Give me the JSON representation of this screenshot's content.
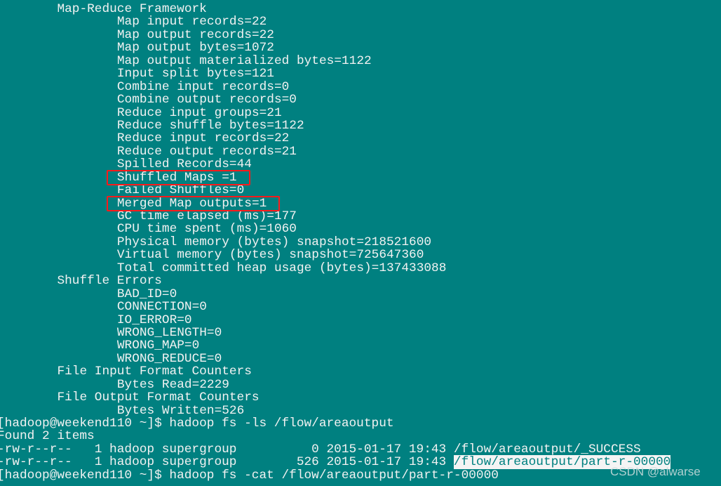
{
  "terminal": {
    "background": "#008080",
    "lines": [
      {
        "indent": 1,
        "text": "Map-Reduce Framework"
      },
      {
        "indent": 2,
        "text": "Map input records=22"
      },
      {
        "indent": 2,
        "text": "Map output records=22"
      },
      {
        "indent": 2,
        "text": "Map output bytes=1072"
      },
      {
        "indent": 2,
        "text": "Map output materialized bytes=1122"
      },
      {
        "indent": 2,
        "text": "Input split bytes=121"
      },
      {
        "indent": 2,
        "text": "Combine input records=0"
      },
      {
        "indent": 2,
        "text": "Combine output records=0"
      },
      {
        "indent": 2,
        "text": "Reduce input groups=21"
      },
      {
        "indent": 2,
        "text": "Reduce shuffle bytes=1122"
      },
      {
        "indent": 2,
        "text": "Reduce input records=22"
      },
      {
        "indent": 2,
        "text": "Reduce output records=21"
      },
      {
        "indent": 2,
        "text": "Spilled Records=44"
      },
      {
        "indent": 2,
        "text": "Shuffled Maps =1",
        "boxed": true
      },
      {
        "indent": 2,
        "text": "Failed Shuffles=0"
      },
      {
        "indent": 2,
        "text": "Merged Map outputs=1",
        "boxed": true
      },
      {
        "indent": 2,
        "text": "GC time elapsed (ms)=177"
      },
      {
        "indent": 2,
        "text": "CPU time spent (ms)=1060"
      },
      {
        "indent": 2,
        "text": "Physical memory (bytes) snapshot=218521600"
      },
      {
        "indent": 2,
        "text": "Virtual memory (bytes) snapshot=725647360"
      },
      {
        "indent": 2,
        "text": "Total committed heap usage (bytes)=137433088"
      },
      {
        "indent": 1,
        "text": "Shuffle Errors"
      },
      {
        "indent": 2,
        "text": "BAD_ID=0"
      },
      {
        "indent": 2,
        "text": "CONNECTION=0"
      },
      {
        "indent": 2,
        "text": "IO_ERROR=0"
      },
      {
        "indent": 2,
        "text": "WRONG_LENGTH=0"
      },
      {
        "indent": 2,
        "text": "WRONG_MAP=0"
      },
      {
        "indent": 2,
        "text": "WRONG_REDUCE=0"
      },
      {
        "indent": 1,
        "text": "File Input Format Counters"
      },
      {
        "indent": 2,
        "text": "Bytes Read=2229"
      },
      {
        "indent": 1,
        "text": "File Output Format Counters"
      },
      {
        "indent": 2,
        "text": "Bytes Written=526"
      },
      {
        "indent": 0,
        "text": "[hadoop@weekend110 ~]$ hadoop fs -ls /flow/areaoutput"
      },
      {
        "indent": 0,
        "text": "Found 2 items"
      },
      {
        "indent": 0,
        "text": "-rw-r--r--   1 hadoop supergroup          0 2015-01-17 19:43 /flow/areaoutput/_SUCCESS"
      },
      {
        "indent": 0,
        "text": "-rw-r--r--   1 hadoop supergroup        526 2015-01-17 19:43 ",
        "highlight": "/flow/areaoutput/part-r-00000"
      },
      {
        "indent": 0,
        "text": "[hadoop@weekend110 ~]$ hadoop fs -cat /flow/areaoutput/part-r-00000"
      }
    ]
  },
  "annotation_color": "#ff1a1a",
  "watermark": "CSDN @alwarse"
}
